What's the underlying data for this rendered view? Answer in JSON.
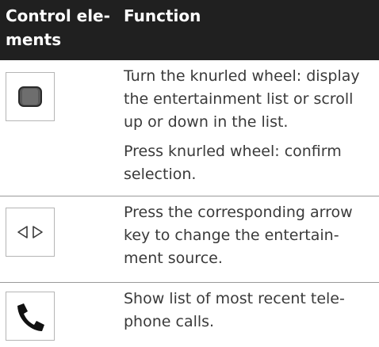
{
  "header": {
    "col1_line1": "Control ele-",
    "col1_line2": "ments",
    "col2": "Function"
  },
  "rows": [
    {
      "icon": "knurled-wheel-icon",
      "paragraphs": [
        [
          "Turn the knurled wheel: display",
          "the entertainment list or scroll",
          "up or down in the list."
        ],
        [
          "Press knurled wheel: confirm",
          "selection."
        ]
      ]
    },
    {
      "icon": "arrow-keys-icon",
      "paragraphs": [
        [
          "Press the corresponding arrow",
          "key to change the entertain-",
          "ment source."
        ]
      ]
    },
    {
      "icon": "telephone-handset-icon",
      "paragraphs": [
        [
          "Show list of most recent tele-",
          "phone calls."
        ]
      ]
    }
  ],
  "colors": {
    "header_bg": "#202020",
    "header_text": "#ffffff",
    "body_text": "#3a3a3a",
    "rule": "#9a9a9a"
  }
}
